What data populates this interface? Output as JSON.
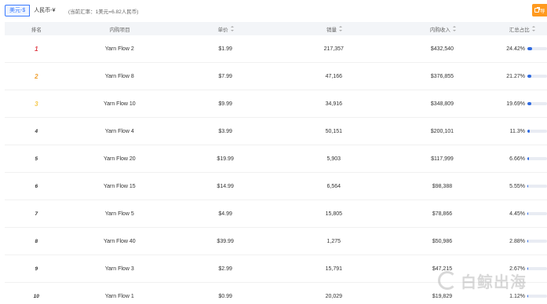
{
  "toolbar": {
    "currency_usd": "美元-$",
    "currency_rmb": "人民币-¥",
    "rate_note": "(当前汇率：1美元=6.82人民币)",
    "export_label": "导"
  },
  "table": {
    "headers": {
      "rank": "排名",
      "item": "内购项目",
      "price": "单价",
      "sales": "销量",
      "revenue": "内购收入",
      "share": "汇总占比"
    },
    "rows": [
      {
        "rank": "1",
        "item": "Yarn Flow 2",
        "price": "$1.99",
        "sales": "217,357",
        "revenue": "$432,540",
        "share": "24.42%",
        "share_value": 24.42
      },
      {
        "rank": "2",
        "item": "Yarn Flow 8",
        "price": "$7.99",
        "sales": "47,166",
        "revenue": "$376,855",
        "share": "21.27%",
        "share_value": 21.27
      },
      {
        "rank": "3",
        "item": "Yarn Flow 10",
        "price": "$9.99",
        "sales": "34,916",
        "revenue": "$348,809",
        "share": "19.69%",
        "share_value": 19.69
      },
      {
        "rank": "4",
        "item": "Yarn Flow 4",
        "price": "$3.99",
        "sales": "50,151",
        "revenue": "$200,101",
        "share": "11.3%",
        "share_value": 11.3
      },
      {
        "rank": "5",
        "item": "Yarn Flow 20",
        "price": "$19.99",
        "sales": "5,903",
        "revenue": "$117,999",
        "share": "6.66%",
        "share_value": 6.66
      },
      {
        "rank": "6",
        "item": "Yarn Flow 15",
        "price": "$14.99",
        "sales": "6,564",
        "revenue": "$98,388",
        "share": "5.55%",
        "share_value": 5.55
      },
      {
        "rank": "7",
        "item": "Yarn Flow 5",
        "price": "$4.99",
        "sales": "15,805",
        "revenue": "$78,866",
        "share": "4.45%",
        "share_value": 4.45
      },
      {
        "rank": "8",
        "item": "Yarn Flow 40",
        "price": "$39.99",
        "sales": "1,275",
        "revenue": "$50,986",
        "share": "2.88%",
        "share_value": 2.88
      },
      {
        "rank": "9",
        "item": "Yarn Flow 3",
        "price": "$2.99",
        "sales": "15,791",
        "revenue": "$47,215",
        "share": "2.67%",
        "share_value": 2.67
      },
      {
        "rank": "10",
        "item": "Yarn Flow 1",
        "price": "$0.99",
        "sales": "20,029",
        "revenue": "$19,829",
        "share": "1.12%",
        "share_value": 1.12
      }
    ]
  },
  "watermark": {
    "text": "白鲸出海"
  },
  "colors": {
    "accent": "#3b7bff",
    "export": "#ff9a1f",
    "bar": "#2e6ae0",
    "bar_track": "#e9ecf3",
    "header_bg": "#f3f5f8"
  }
}
